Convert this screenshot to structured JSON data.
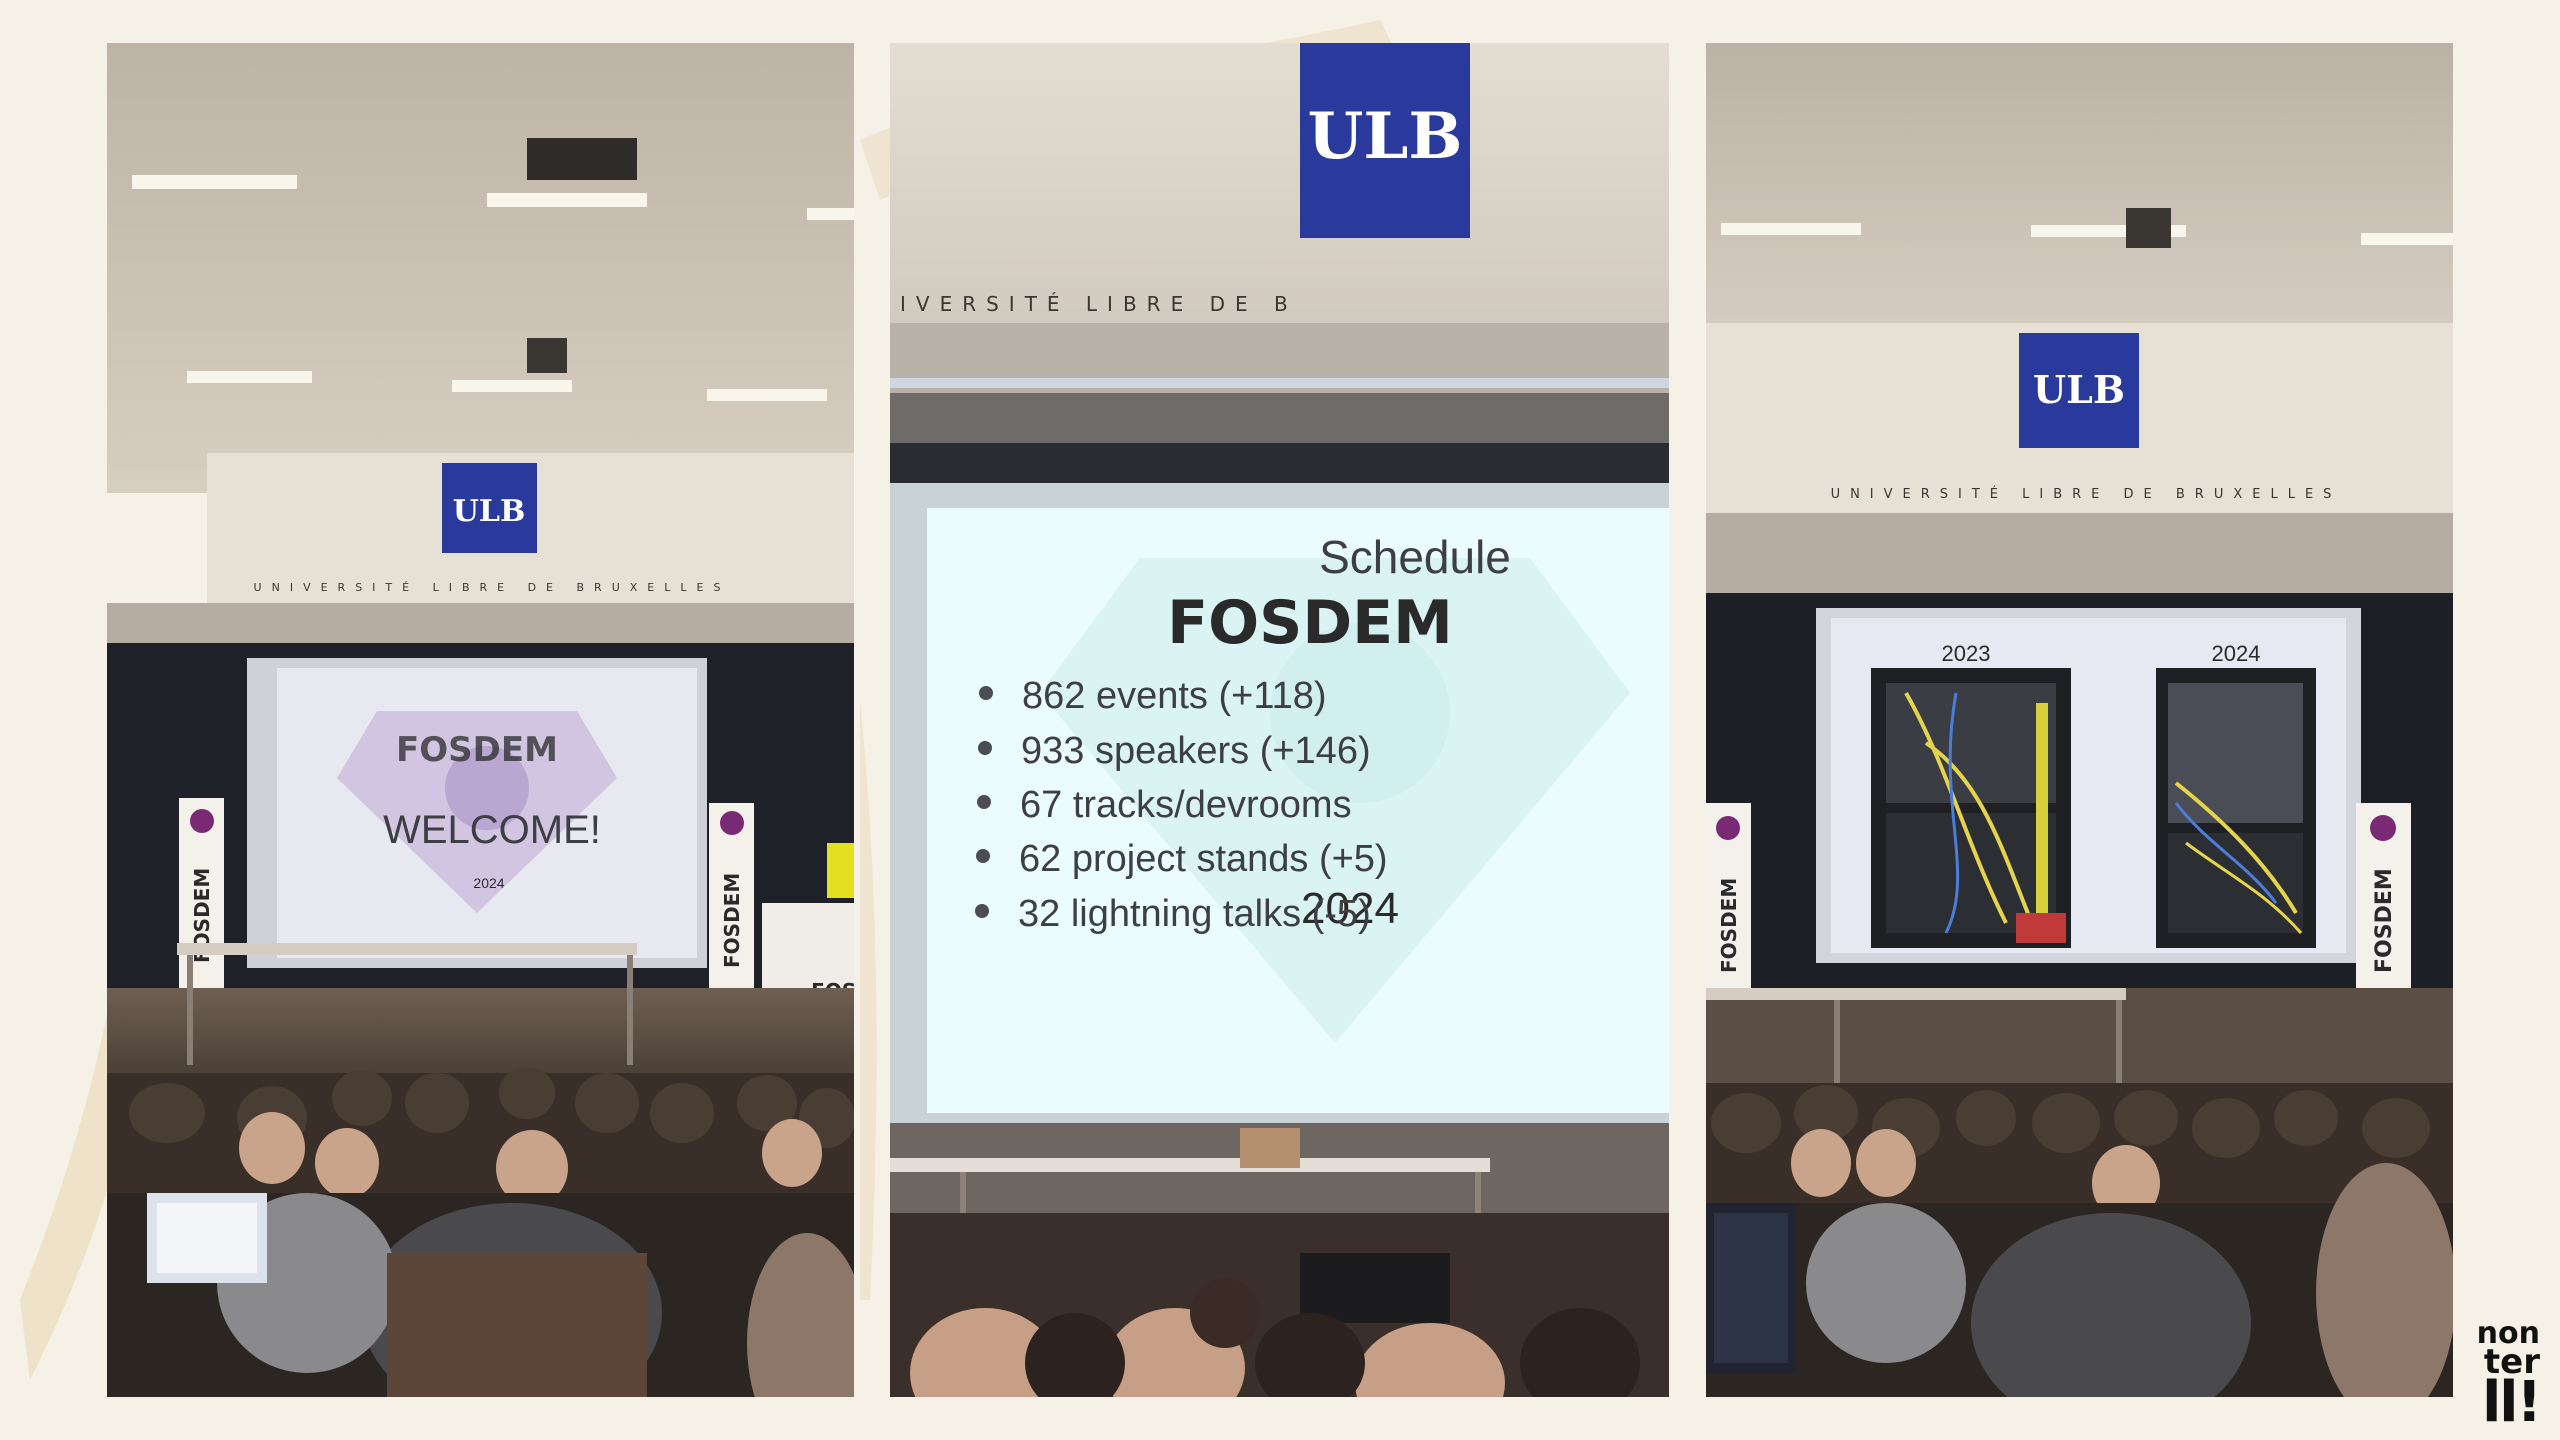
{
  "left": {
    "ulb": "ULB",
    "university": "UNIVERSITÉ LIBRE DE BRUXELLES",
    "slide_brand": "FOSDEM",
    "slide_text": "WELCOME!",
    "slide_year": "2024",
    "banner": "FOSDEM",
    "podium": "FOSD"
  },
  "middle": {
    "ulb": "ULB",
    "university": "IVERSITÉ LIBRE DE B",
    "slide_title": "Schedule",
    "stats": [
      "862 events (+118)",
      "933 speakers (+146)",
      "67 tracks/devrooms",
      "62 project stands (+5)",
      "32 lightning talks (-5)"
    ],
    "watermark_brand": "FOSDEM",
    "watermark_year": "2024"
  },
  "right": {
    "ulb": "ULB",
    "university": "UNIVERSITÉ LIBRE DE BRUXELLES",
    "year_before": "2023",
    "year_after": "2024",
    "banner": "FOSDEM"
  },
  "corner_logo": [
    "non",
    "ter",
    "ll!"
  ],
  "colors": {
    "background": "#f6f1e6",
    "ulb_blue": "#2a3a9c",
    "screen_light": "#eef3f7",
    "slide_cyan": "#eafcfb"
  }
}
